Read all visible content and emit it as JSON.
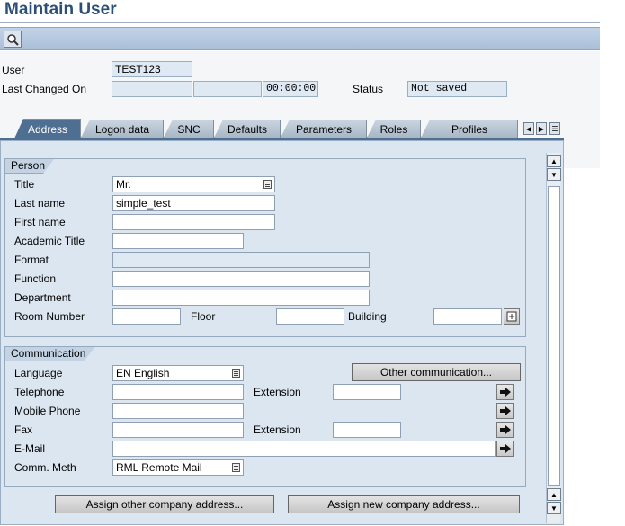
{
  "window": {
    "title": "Maintain User"
  },
  "toolbar": {
    "icon": "magnifier-icon"
  },
  "header": {
    "user_label": "User",
    "user_value": "TEST123",
    "last_changed_label": "Last Changed On",
    "last_changed_by": "",
    "last_changed_date": "",
    "last_changed_time": "00:00:00",
    "status_label": "Status",
    "status_value": "Not saved"
  },
  "tabs": [
    {
      "label": "Address",
      "active": true
    },
    {
      "label": "Logon data"
    },
    {
      "label": "SNC"
    },
    {
      "label": "Defaults"
    },
    {
      "label": "Parameters"
    },
    {
      "label": "Roles"
    },
    {
      "label": "Profiles"
    }
  ],
  "person": {
    "heading": "Person",
    "title_label": "Title",
    "title_value": "Mr.",
    "last_name_label": "Last name",
    "last_name_value": "simple_test",
    "first_name_label": "First name",
    "first_name_value": "",
    "academic_title_label": "Academic Title",
    "academic_title_value": "",
    "format_label": "Format",
    "format_value": "",
    "function_label": "Function",
    "function_value": "",
    "department_label": "Department",
    "department_value": "",
    "room_label": "Room Number",
    "room_value": "",
    "floor_label": "Floor",
    "floor_value": "",
    "building_label": "Building",
    "building_value": ""
  },
  "communication": {
    "heading": "Communication",
    "language_label": "Language",
    "language_value": "EN English",
    "other_comm_button": "Other communication...",
    "telephone_label": "Telephone",
    "telephone_value": "",
    "tel_ext_label": "Extension",
    "tel_ext_value": "",
    "mobile_label": "Mobile Phone",
    "mobile_value": "",
    "fax_label": "Fax",
    "fax_value": "",
    "fax_ext_label": "Extension",
    "fax_ext_value": "",
    "email_label": "E-Mail",
    "email_value": "",
    "comm_meth_label": "Comm. Meth",
    "comm_meth_value": "RML Remote Mail"
  },
  "footer": {
    "assign_other_button": "Assign other company address...",
    "assign_new_button": "Assign new company address..."
  }
}
